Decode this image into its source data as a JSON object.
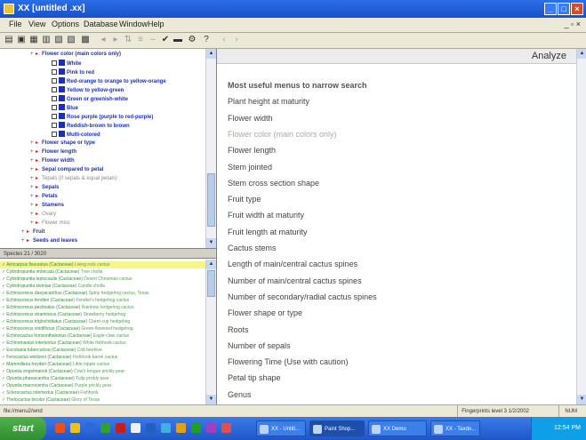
{
  "window": {
    "title": "XX   [untitled .xx]",
    "min": "_",
    "max": "□",
    "close": "×"
  },
  "menu": {
    "items": [
      "File",
      "View",
      "Options",
      "Database",
      "Window",
      "Help"
    ],
    "mdi_controls": "_ ▫ ×"
  },
  "toolbar": {
    "icons": [
      "open-icon",
      "save-icon",
      "print-icon",
      "table-icon",
      "copy-icon",
      "tree-icon",
      "filter-icon",
      "back-icon",
      "forward-icon",
      "sort-icon",
      "ok-icon",
      "check-icon",
      "gear-icon",
      "help-icon",
      "prev-icon",
      "next-icon"
    ]
  },
  "tree": {
    "items": [
      {
        "indent": 0,
        "kind": "folder",
        "label": "Flower color (main colors only)",
        "color": "#1a2fbf"
      },
      {
        "indent": 2,
        "kind": "value",
        "label": "White",
        "color": "#1a2fbf"
      },
      {
        "indent": 2,
        "kind": "value",
        "label": "Pink to red",
        "color": "#1a2fbf"
      },
      {
        "indent": 2,
        "kind": "value",
        "label": "Red-orange to orange to yellow-orange",
        "color": "#1a2fbf"
      },
      {
        "indent": 2,
        "kind": "value",
        "label": "Yellow to yellow-green",
        "color": "#1a2fbf"
      },
      {
        "indent": 2,
        "kind": "value",
        "label": "Green or greenish-white",
        "color": "#1a2fbf"
      },
      {
        "indent": 2,
        "kind": "value",
        "label": "Blue",
        "color": "#1a2fbf"
      },
      {
        "indent": 2,
        "kind": "value",
        "label": "Rose purple (purple to red-purple)",
        "color": "#1a2fbf"
      },
      {
        "indent": 2,
        "kind": "value",
        "label": "Reddish-brown to brown",
        "color": "#1a2fbf"
      },
      {
        "indent": 2,
        "kind": "value",
        "label": "Multi-colored",
        "color": "#1a2fbf"
      },
      {
        "indent": 0,
        "kind": "folder",
        "label": "Flower shape or type",
        "color": "#1a2fbf"
      },
      {
        "indent": 0,
        "kind": "folder",
        "label": "Flower length",
        "color": "#1a2fbf"
      },
      {
        "indent": 0,
        "kind": "folder",
        "label": "Flower width",
        "color": "#1a2fbf"
      },
      {
        "indent": 0,
        "kind": "folder",
        "label": "Sepal compared to petal",
        "color": "#1a2fbf"
      },
      {
        "indent": 0,
        "kind": "folder",
        "label": "Tepals (if sepals & equal petals)",
        "color": "#8a8a8a"
      },
      {
        "indent": 0,
        "kind": "folder",
        "label": "Sepals",
        "color": "#1a2fbf"
      },
      {
        "indent": 0,
        "kind": "folder",
        "label": "Petals",
        "color": "#1a2fbf"
      },
      {
        "indent": 0,
        "kind": "folder",
        "label": "Stamens",
        "color": "#1a2fbf"
      },
      {
        "indent": 0,
        "kind": "folder",
        "label": "Ovary",
        "color": "#8a8a8a"
      },
      {
        "indent": 0,
        "kind": "folder",
        "label": "Flower misc",
        "color": "#8a8a8a"
      },
      {
        "indent": -1,
        "kind": "folder",
        "label": "Fruit",
        "color": "#1a2fbf"
      },
      {
        "indent": -1,
        "kind": "folder",
        "label": "Seeds and leaves",
        "color": "#1a2fbf"
      }
    ]
  },
  "split_label": "Species 21 / 3020",
  "species": [
    {
      "name": "Ariocarpus fissuratus (Cactaceae)",
      "common": "Living rock cactus"
    },
    {
      "name": "Cylindropuntia imbricata (Cactaceae)",
      "common": "Tree cholla"
    },
    {
      "name": "Cylindropuntia leptocaulis (Cactaceae)",
      "common": "Desert Christmas cactus"
    },
    {
      "name": "Cylindropuntia kleiniae (Cactaceae)",
      "common": "Candle cholla"
    },
    {
      "name": "Echinocereus dasyacanthus (Cactaceae)",
      "common": "Spiny hedgehog cactus, Texas"
    },
    {
      "name": "Echinocereus fendleri (Cactaceae)",
      "common": "Fendler's hedgehog cactus"
    },
    {
      "name": "Echinocereus pectinatus (Cactaceae)",
      "common": "Rainbow hedgehog cactus"
    },
    {
      "name": "Echinocereus stramineus (Cactaceae)",
      "common": "Strawberry hedgehog"
    },
    {
      "name": "Echinocereus triglochidiatus (Cactaceae)",
      "common": "Claret-cup hedgehog"
    },
    {
      "name": "Echinocereus viridiflorus (Cactaceae)",
      "common": "Green-flowered hedgehog"
    },
    {
      "name": "Echinocactus horizonthalonius (Cactaceae)",
      "common": "Eagle-claw cactus"
    },
    {
      "name": "Echinomastus intertextus (Cactaceae)",
      "common": "White fishhook cactus"
    },
    {
      "name": "Escobaria tuberculosa (Cactaceae)",
      "common": "Cob beehive"
    },
    {
      "name": "Ferocactus wislizeni (Cactaceae)",
      "common": "Fishhook barrel cactus"
    },
    {
      "name": "Mammillaria heyderi (Cactaceae)",
      "common": "Little nipple cactus"
    },
    {
      "name": "Opuntia engelmannii (Cactaceae)",
      "common": "Cow's tongue prickly pear"
    },
    {
      "name": "Opuntia phaeacantha (Cactaceae)",
      "common": "Tulip prickly pear"
    },
    {
      "name": "Opuntia macrocentra (Cactaceae)",
      "common": "Purple prickly pear"
    },
    {
      "name": "Sclerocactus intertextus (Cactaceae)",
      "common": "Fishhook"
    },
    {
      "name": "Thelocactus bicolor (Cactaceae)",
      "common": "Glory of Texas"
    }
  ],
  "analyze": {
    "title": "Analyze",
    "items": [
      {
        "label": "Most useful menus to narrow search",
        "style": "hdr"
      },
      {
        "label": "Plant height at maturity",
        "style": ""
      },
      {
        "label": "Flower width",
        "style": ""
      },
      {
        "label": "Flower color (main colors only)",
        "style": "gray"
      },
      {
        "label": "Flower length",
        "style": ""
      },
      {
        "label": "Stem jointed",
        "style": ""
      },
      {
        "label": "Stem cross section shape",
        "style": ""
      },
      {
        "label": "Fruit type",
        "style": ""
      },
      {
        "label": "Fruit width at maturity",
        "style": ""
      },
      {
        "label": "Fruit length at maturity",
        "style": ""
      },
      {
        "label": "Cactus stems",
        "style": ""
      },
      {
        "label": "Length of main/central cactus spines",
        "style": ""
      },
      {
        "label": "Number of main/central cactus spines",
        "style": ""
      },
      {
        "label": "Number of secondary/radial cactus spines",
        "style": ""
      },
      {
        "label": "Flower shape or type",
        "style": ""
      },
      {
        "label": "Roots",
        "style": ""
      },
      {
        "label": "Number of sepals",
        "style": ""
      },
      {
        "label": "Flowering Time (Use with caution)",
        "style": ""
      },
      {
        "label": "Petal tip shape",
        "style": ""
      },
      {
        "label": "Genus",
        "style": ""
      }
    ]
  },
  "status": {
    "left": "file://menu2/wnd",
    "right": "Fingerprints level 3  1/2/2002",
    "right2": "NUM"
  },
  "taskbar": {
    "start": "start",
    "quick_launch_colors": [
      "#e85020",
      "#f0c020",
      "#2a6ad8",
      "#30a030",
      "#c02020",
      "#f0f0f0",
      "#2060c0",
      "#40b0e0",
      "#e0a020",
      "#20a020",
      "#a040c0",
      "#e05050"
    ],
    "buttons": [
      "XX - Untitl...",
      "Paint Shop...",
      "XX Demo",
      "XX - Taxdo..."
    ],
    "tray": "12:54 PM"
  }
}
